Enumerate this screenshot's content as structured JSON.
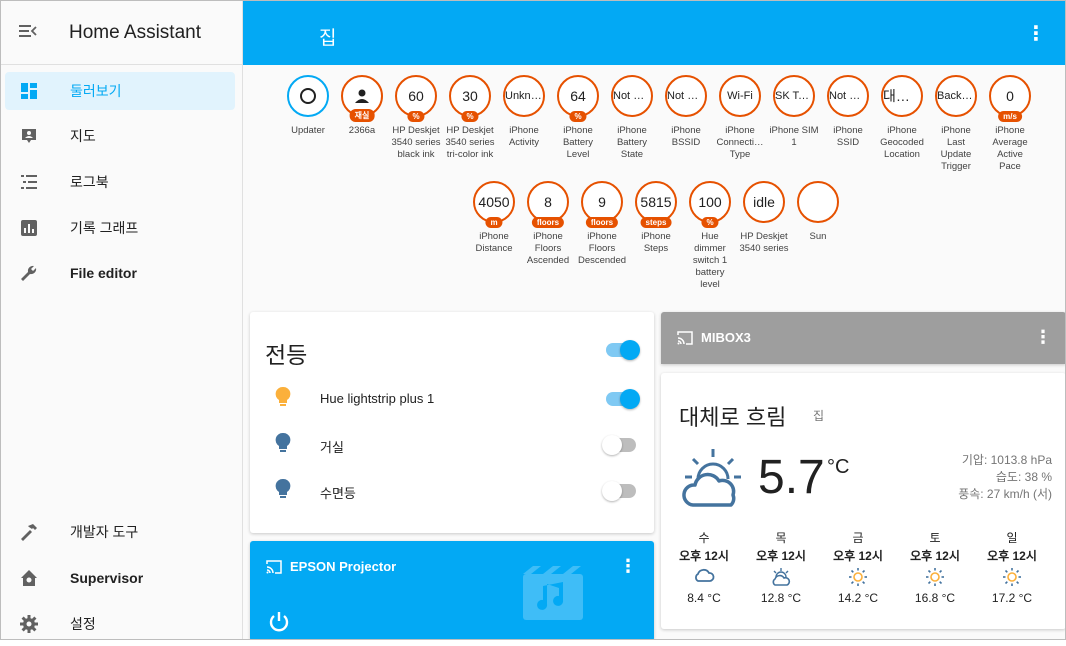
{
  "app": {
    "title": "Home Assistant"
  },
  "sidebar": {
    "items": [
      {
        "label": "둘러보기",
        "icon": "dashboard-icon",
        "active": true
      },
      {
        "label": "지도",
        "icon": "map-account-icon"
      },
      {
        "label": "로그북",
        "icon": "logbook-list-icon"
      },
      {
        "label": "기록 그래프",
        "icon": "history-chart-icon"
      },
      {
        "label": "File editor",
        "icon": "wrench-icon"
      },
      {
        "label": "개발자 도구",
        "icon": "hammer-icon"
      },
      {
        "label": "Supervisor",
        "icon": "supervisor-house-icon"
      },
      {
        "label": "설정",
        "icon": "gear-icon"
      }
    ]
  },
  "header": {
    "title": "집"
  },
  "badges": [
    {
      "value": "",
      "unit": "",
      "name": "Updater",
      "icon": "circle-outline-icon"
    },
    {
      "value": "",
      "unit": "재실",
      "name": "2366a",
      "icon": "person-icon"
    },
    {
      "value": "60",
      "unit": "%",
      "name": "HP Deskjet 3540 series black ink"
    },
    {
      "value": "30",
      "unit": "%",
      "name": "HP Deskjet 3540 series tri-color ink"
    },
    {
      "value": "Unkno…",
      "unit": "",
      "name": "iPhone Activity"
    },
    {
      "value": "64",
      "unit": "%",
      "name": "iPhone Battery Level"
    },
    {
      "value": "Not C…",
      "unit": "",
      "name": "iPhone Battery State"
    },
    {
      "value": "Not C…",
      "unit": "",
      "name": "iPhone BSSID"
    },
    {
      "value": "Wi-Fi",
      "unit": "",
      "name": "iPhone Connecti… Type"
    },
    {
      "value": "SK Tel…",
      "unit": "",
      "name": "iPhone SIM 1"
    },
    {
      "value": "Not C…",
      "unit": "",
      "name": "iPhone SSID"
    },
    {
      "value": "대한…",
      "unit": "",
      "name": "iPhone Geocoded Location"
    },
    {
      "value": "Backg…",
      "unit": "",
      "name": "iPhone Last Update Trigger"
    },
    {
      "value": "0",
      "unit": "m/s",
      "name": "iPhone Average Active Pace"
    },
    {
      "value": "4050",
      "unit": "m",
      "name": "iPhone Distance"
    },
    {
      "value": "8",
      "unit": "floors",
      "name": "iPhone Floors Ascended"
    },
    {
      "value": "9",
      "unit": "floors",
      "name": "iPhone Floors Descended"
    },
    {
      "value": "5815",
      "unit": "steps",
      "name": "iPhone Steps"
    },
    {
      "value": "100",
      "unit": "%",
      "name": "Hue dimmer switch 1 battery level"
    },
    {
      "value": "idle",
      "unit": "",
      "name": "HP Deskjet 3540 series"
    },
    {
      "value": "",
      "unit": "",
      "name": "Sun",
      "icon": "moon-icon"
    }
  ],
  "lights": {
    "title": "전등",
    "master_on": true,
    "rows": [
      {
        "name": "Hue lightstrip plus 1",
        "on": true,
        "color": "#fbb03b"
      },
      {
        "name": "거실",
        "on": false,
        "color": "#44739e"
      },
      {
        "name": "수면등",
        "on": false,
        "color": "#44739e"
      }
    ]
  },
  "media1": {
    "name": "EPSON Projector",
    "color": "#03a9f4"
  },
  "media2": {
    "name": "MIBOX3",
    "color": "#9e9e9e"
  },
  "weather": {
    "condition": "대체로 흐림",
    "location": "집",
    "temp": "5.7",
    "unit": "°C",
    "pressure": "기압: 1013.8 hPa",
    "humidity": "습도: 38 %",
    "wind": "풍속: 27 km/h (서)",
    "forecast": [
      {
        "day": "수",
        "time": "오후 12시",
        "icon": "cloud-icon",
        "temp": "8.4 °C"
      },
      {
        "day": "목",
        "time": "오후 12시",
        "icon": "partly-cloudy-icon",
        "temp": "12.8 °C"
      },
      {
        "day": "금",
        "time": "오후 12시",
        "icon": "sunny-icon",
        "temp": "14.2 °C"
      },
      {
        "day": "토",
        "time": "오후 12시",
        "icon": "sunny-icon",
        "temp": "16.8 °C"
      },
      {
        "day": "일",
        "time": "오후 12시",
        "icon": "sunny-icon",
        "temp": "17.2 °C"
      }
    ]
  },
  "colors": {
    "primary": "#03a9f4",
    "badge_border": "#e65100",
    "sidebar_active_bg": "#e1f3fd"
  }
}
